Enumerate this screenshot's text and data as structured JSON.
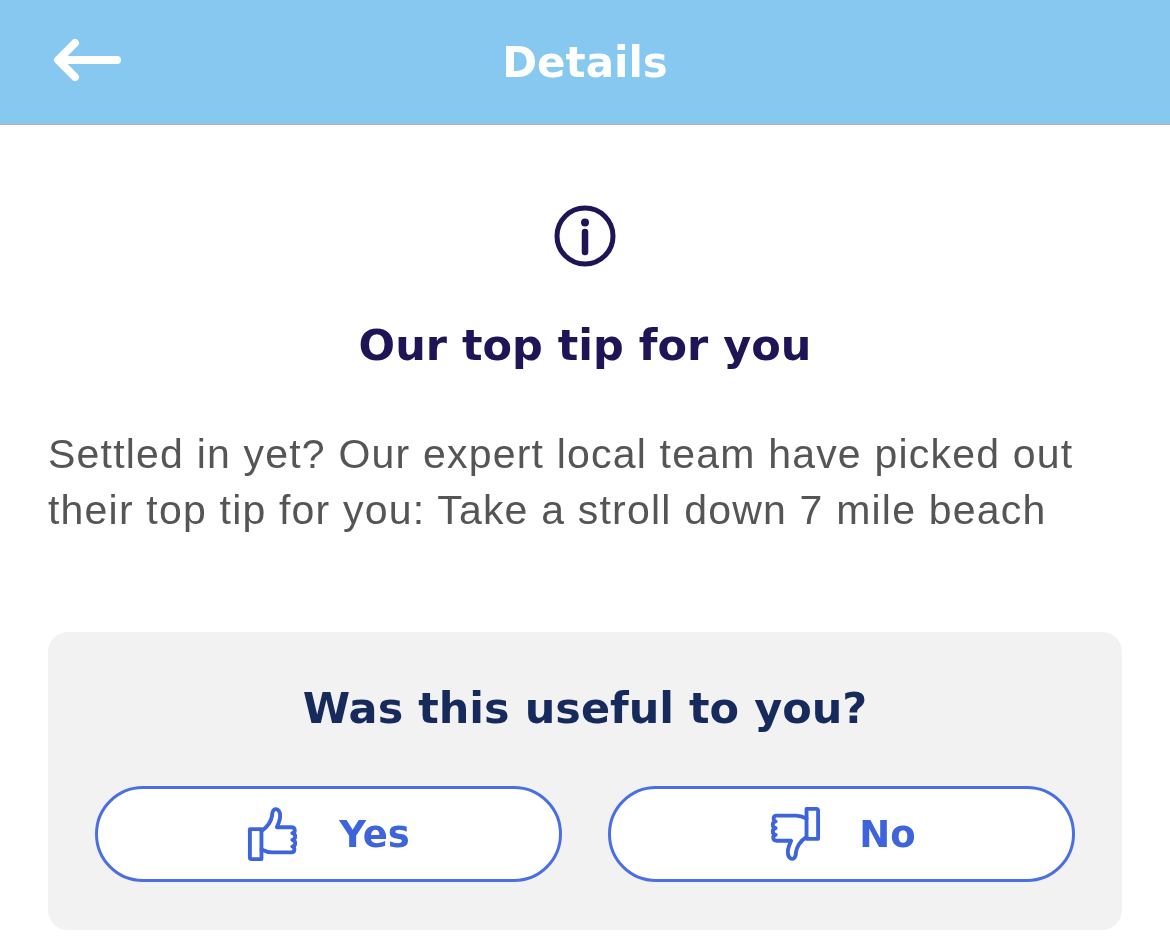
{
  "header": {
    "title": "Details"
  },
  "tip": {
    "heading": "Our top tip for you",
    "text": "Settled in yet? Our expert local team have picked out their top tip for you: Take a stroll down 7 mile beach"
  },
  "feedback": {
    "question": "Was this useful to you?",
    "buttons": [
      {
        "kind": "thumbs-up",
        "label": "Yes"
      },
      {
        "kind": "thumbs-down",
        "label": "No"
      }
    ]
  }
}
